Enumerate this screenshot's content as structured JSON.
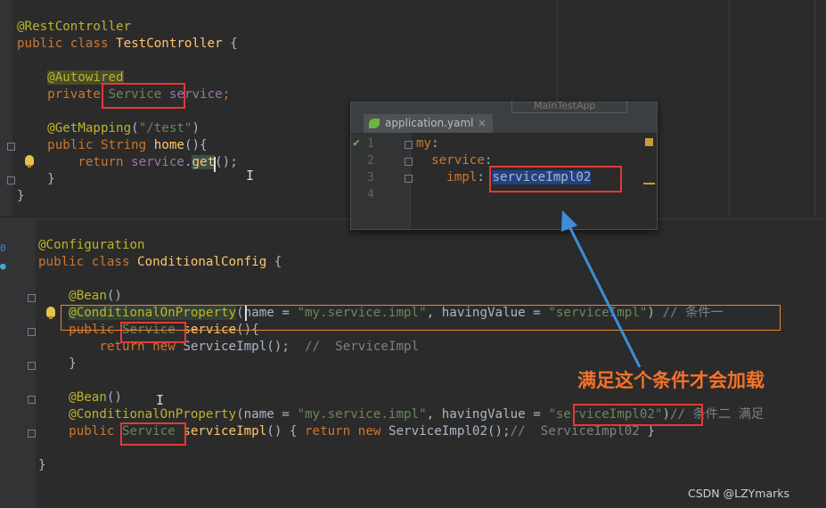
{
  "top_editor": {
    "lines": [
      {
        "tokens": [
          {
            "t": "@RestController",
            "c": "an"
          }
        ]
      },
      {
        "tokens": [
          {
            "t": "public class ",
            "c": "kw"
          },
          {
            "t": "TestController",
            "c": "def"
          },
          {
            "t": " {",
            "c": ""
          }
        ]
      },
      {
        "tokens": []
      },
      {
        "tokens": [
          {
            "t": "    ",
            "c": ""
          },
          {
            "t": "@Autowired",
            "c": "an"
          }
        ]
      },
      {
        "tokens": [
          {
            "t": "    ",
            "c": ""
          },
          {
            "t": "private ",
            "c": "kw"
          },
          {
            "t": "Service",
            "c": "str"
          },
          {
            "t": " ",
            "c": ""
          },
          {
            "t": "service",
            "c": "fld"
          },
          {
            "t": ";",
            "c": "kw"
          }
        ]
      },
      {
        "tokens": []
      },
      {
        "tokens": [
          {
            "t": "    ",
            "c": ""
          },
          {
            "t": "@GetMapping",
            "c": "an"
          },
          {
            "t": "(",
            "c": ""
          },
          {
            "t": "\"/test\"",
            "c": "str"
          },
          {
            "t": ")",
            "c": ""
          }
        ]
      },
      {
        "tokens": [
          {
            "t": "    ",
            "c": ""
          },
          {
            "t": "public ",
            "c": "kw"
          },
          {
            "t": "String ",
            "c": "kw"
          },
          {
            "t": "home",
            "c": "def"
          },
          {
            "t": "(){",
            "c": ""
          }
        ]
      },
      {
        "tokens": [
          {
            "t": "        ",
            "c": ""
          },
          {
            "t": "return ",
            "c": "kw"
          },
          {
            "t": "service",
            "c": "fld"
          },
          {
            "t": ".",
            "c": ""
          },
          {
            "t": "get",
            "c": "def"
          },
          {
            "t": "();",
            "c": ""
          }
        ]
      },
      {
        "tokens": [
          {
            "t": "    }",
            "c": ""
          }
        ]
      },
      {
        "tokens": [
          {
            "t": "}",
            "c": ""
          }
        ]
      }
    ]
  },
  "bottom_editor": {
    "lines": [
      {
        "tokens": [
          {
            "t": "@Configuration",
            "c": "an"
          }
        ]
      },
      {
        "tokens": [
          {
            "t": "public class ",
            "c": "kw"
          },
          {
            "t": "ConditionalConfig",
            "c": "def"
          },
          {
            "t": " {",
            "c": ""
          }
        ]
      },
      {
        "tokens": []
      },
      {
        "tokens": [
          {
            "t": "    ",
            "c": ""
          },
          {
            "t": "@Bean",
            "c": "an"
          },
          {
            "t": "()",
            "c": ""
          }
        ]
      },
      {
        "tokens": [
          {
            "t": "    ",
            "c": ""
          },
          {
            "t": "@ConditionalOnProperty",
            "c": "an"
          },
          {
            "t": "(name = ",
            "c": ""
          },
          {
            "t": "\"my.service.impl\"",
            "c": "str"
          },
          {
            "t": ", havingValue = ",
            "c": ""
          },
          {
            "t": "\"serviceImpl\"",
            "c": "str"
          },
          {
            "t": ") ",
            "c": ""
          },
          {
            "t": "// 条件一",
            "c": "cm"
          }
        ]
      },
      {
        "tokens": [
          {
            "t": "    ",
            "c": ""
          },
          {
            "t": "public ",
            "c": "kw"
          },
          {
            "t": "Service",
            "c": "str"
          },
          {
            "t": " ",
            "c": ""
          },
          {
            "t": "service",
            "c": "def"
          },
          {
            "t": "(){",
            "c": ""
          }
        ]
      },
      {
        "tokens": [
          {
            "t": "        ",
            "c": ""
          },
          {
            "t": "return new ",
            "c": "kw"
          },
          {
            "t": "ServiceImpl();  ",
            "c": ""
          },
          {
            "t": "//  ServiceImpl",
            "c": "cm"
          }
        ]
      },
      {
        "tokens": [
          {
            "t": "    }",
            "c": ""
          }
        ]
      },
      {
        "tokens": []
      },
      {
        "tokens": [
          {
            "t": "    ",
            "c": ""
          },
          {
            "t": "@Bean",
            "c": "an"
          },
          {
            "t": "()",
            "c": ""
          }
        ]
      },
      {
        "tokens": [
          {
            "t": "    ",
            "c": ""
          },
          {
            "t": "@ConditionalOnProperty",
            "c": "an"
          },
          {
            "t": "(name = ",
            "c": ""
          },
          {
            "t": "\"my.service.impl\"",
            "c": "str"
          },
          {
            "t": ", havingValue = ",
            "c": ""
          },
          {
            "t": "\"serviceImpl02\"",
            "c": "str"
          },
          {
            "t": ")",
            "c": ""
          },
          {
            "t": "// 条件二 满足",
            "c": "cm"
          }
        ]
      },
      {
        "tokens": [
          {
            "t": "    ",
            "c": ""
          },
          {
            "t": "public ",
            "c": "kw"
          },
          {
            "t": "Service",
            "c": "str"
          },
          {
            "t": " ",
            "c": ""
          },
          {
            "t": "serviceImpl",
            "c": "def"
          },
          {
            "t": "() { ",
            "c": ""
          },
          {
            "t": "return new ",
            "c": "kw"
          },
          {
            "t": "ServiceImpl02();",
            "c": ""
          },
          {
            "t": "//  ServiceImpl02",
            "c": "cm"
          },
          {
            "t": " }",
            "c": ""
          }
        ]
      },
      {
        "tokens": []
      },
      {
        "tokens": [
          {
            "t": "}",
            "c": ""
          }
        ]
      }
    ]
  },
  "yaml_popup": {
    "tab_label": "application.yaml",
    "close_glyph": "×",
    "other_tab": "MainTestApp",
    "line_numbers": [
      "1",
      "2",
      "3",
      "4"
    ],
    "lines": [
      {
        "tokens": [
          {
            "t": "my",
            "c": "kw"
          },
          {
            "t": ":",
            "c": ""
          }
        ]
      },
      {
        "tokens": [
          {
            "t": "  ",
            "c": ""
          },
          {
            "t": "service",
            "c": "kw"
          },
          {
            "t": ":",
            "c": ""
          }
        ]
      },
      {
        "tokens": [
          {
            "t": "    ",
            "c": ""
          },
          {
            "t": "impl",
            "c": "kw"
          },
          {
            "t": ": ",
            "c": ""
          },
          {
            "t": "serviceImpl02",
            "c": ""
          }
        ]
      },
      {
        "tokens": []
      }
    ]
  },
  "annotation": {
    "notice": "满足这个条件才会加载",
    "arrow_color": "#3b8fd9",
    "box_color": "#e53935",
    "orange_box_color": "#e8872d"
  },
  "watermark": "CSDN @LZYmarks"
}
